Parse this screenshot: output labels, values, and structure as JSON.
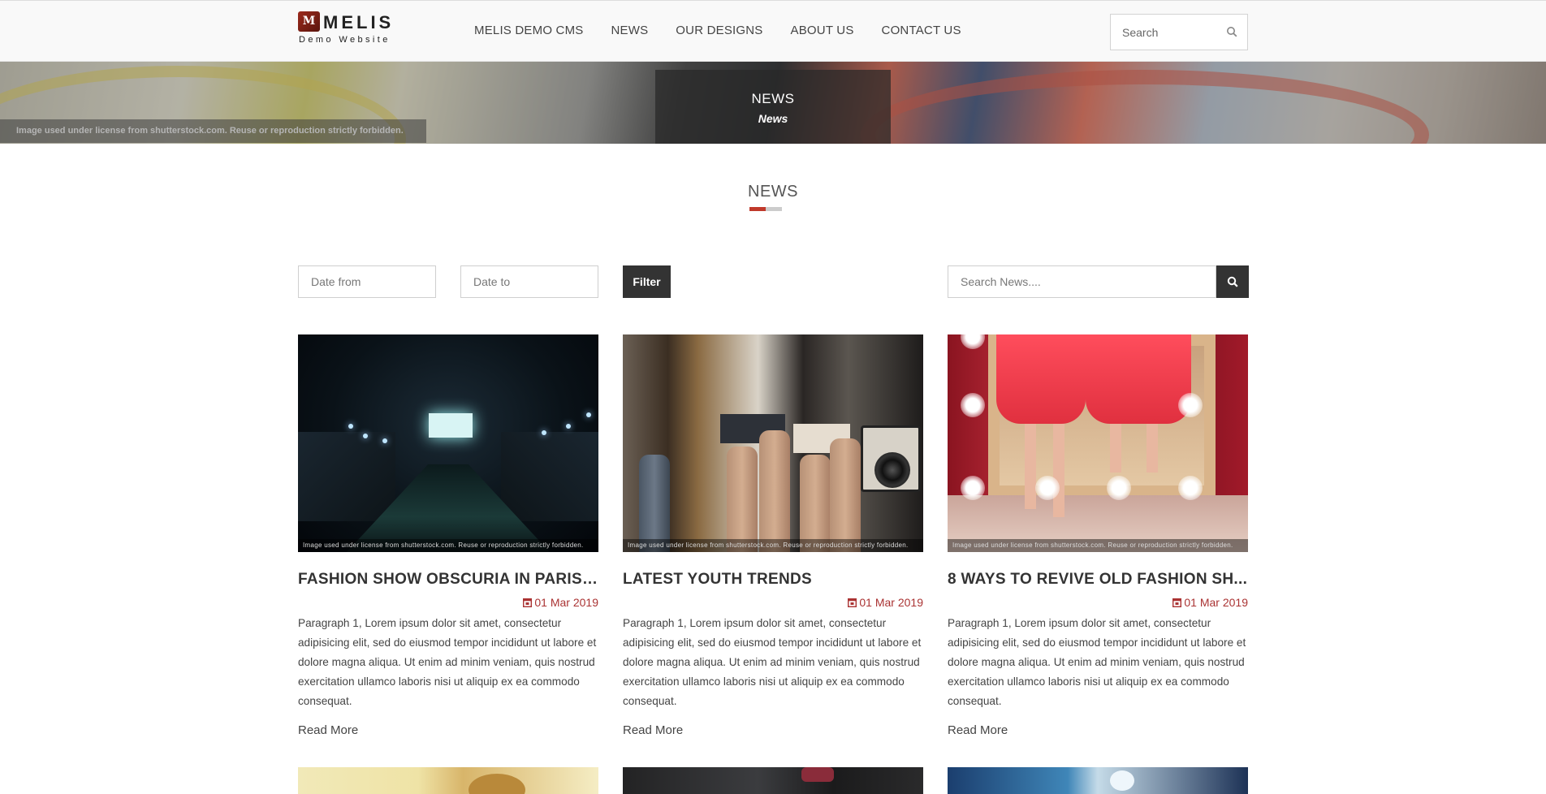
{
  "header": {
    "logo_mark": "M",
    "logo_name": "MELIS",
    "logo_sub": "Demo Website",
    "nav": [
      "MELIS DEMO CMS",
      "NEWS",
      "OUR DESIGNS",
      "ABOUT US",
      "CONTACT US"
    ],
    "search_placeholder": "Search",
    "search_icon": "search-icon"
  },
  "banner": {
    "license": "Image used under license from shutterstock.com. Reuse or reproduction strictly forbidden.",
    "title": "NEWS",
    "breadcrumb": "News"
  },
  "section": {
    "title": "NEWS",
    "accent_color": "#c0392b"
  },
  "filters": {
    "date_from_placeholder": "Date from",
    "date_to_placeholder": "Date to",
    "filter_label": "Filter",
    "search_placeholder": "Search News....",
    "search_icon": "search-icon"
  },
  "cards": [
    {
      "title": "FASHION SHOW OBSCURIA IN PARIS ...",
      "date": "01 Mar 2019",
      "text": "Paragraph 1, Lorem ipsum dolor sit amet, consectetur adipisicing elit, sed do eiusmod tempor incididunt ut labore et dolore magna aliqua. Ut enim ad minim veniam, quis nostrud exercitation ullamco laboris nisi ut aliquip ex ea commodo consequat.",
      "read_more": "Read More",
      "license": "Image used under license from shutterstock.com. Reuse or reproduction strictly forbidden."
    },
    {
      "title": "LATEST YOUTH TRENDS",
      "date": "01 Mar 2019",
      "text": "Paragraph 1, Lorem ipsum dolor sit amet, consectetur adipisicing elit, sed do eiusmod tempor incididunt ut labore et dolore magna aliqua. Ut enim ad minim veniam, quis nostrud exercitation ullamco laboris nisi ut aliquip ex ea commodo consequat.",
      "read_more": "Read More",
      "license": "Image used under license from shutterstock.com. Reuse or reproduction strictly forbidden."
    },
    {
      "title": "8 WAYS TO REVIVE OLD FASHION SH...",
      "date": "01 Mar 2019",
      "text": "Paragraph 1, Lorem ipsum dolor sit amet, consectetur adipisicing elit, sed do eiusmod tempor incididunt ut labore et dolore magna aliqua. Ut enim ad minim veniam, quis nostrud exercitation ullamco laboris nisi ut aliquip ex ea commodo consequat.",
      "read_more": "Read More",
      "license": "Image used under license from shutterstock.com. Reuse or reproduction strictly forbidden."
    }
  ]
}
